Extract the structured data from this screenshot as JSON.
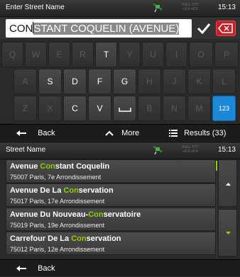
{
  "screen1": {
    "status": {
      "title": "Enter Street Name",
      "time": "15:13",
      "gps_info": "FULL 7/77 +0.0 +0.0"
    },
    "input": {
      "typed": "CON",
      "suggested": "STANT COQUELIN (AVENUE)"
    },
    "keyboard": {
      "row1": [
        "Q",
        "W",
        "E",
        "R",
        "T",
        "Y",
        "U",
        "I",
        "O",
        "P"
      ],
      "row2": [
        "A",
        "S",
        "D",
        "F",
        "G",
        "H",
        "J",
        "K",
        "L"
      ],
      "row3": [
        "Z",
        "X",
        "C",
        "V",
        "␣",
        "B",
        "N",
        "M",
        "123"
      ]
    },
    "bottom": {
      "back": "Back",
      "more": "More",
      "results": "Results (33)"
    }
  },
  "screen2": {
    "status": {
      "title": "Street Name",
      "time": "15:13",
      "gps_info": "FULL 7/77 +0.0 +0.0"
    },
    "results": [
      {
        "pre": "Avenue ",
        "hl": "Con",
        "post": "stant Coquelin",
        "addr": "75007 Paris, 7e Arrondissement"
      },
      {
        "pre": "Avenue De La ",
        "hl": "Con",
        "post": "servation",
        "addr": "75017 Paris, 17e Arrondissement"
      },
      {
        "pre": "Avenue Du Nouveau-",
        "hl": "Con",
        "post": "servatoire",
        "addr": "75019 Paris, 19e Arrondissement"
      },
      {
        "pre": "Carrefour De La ",
        "hl": "Con",
        "post": "servation",
        "addr": "75012 Paris, 12e Arrondissement"
      }
    ],
    "bottom": {
      "back": "Back"
    }
  },
  "colors": {
    "highlight": "#8fd000",
    "delete": "#c2202a",
    "numkey": "#1e88d8"
  }
}
